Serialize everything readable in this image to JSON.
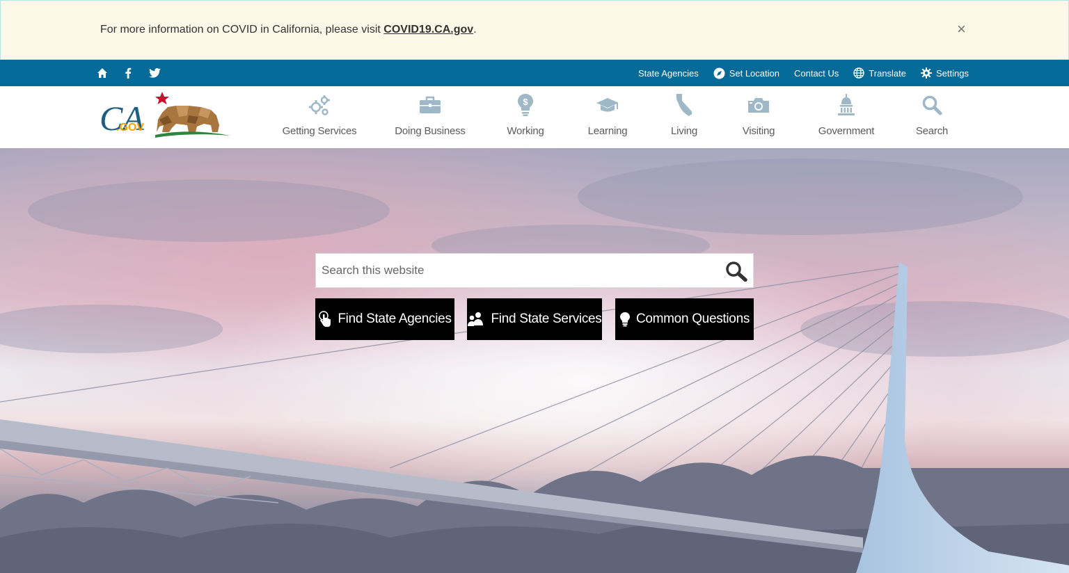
{
  "alert": {
    "text": "For more information on COVID in California, please visit ",
    "link": "COVID19.CA.gov",
    "suffix": ".",
    "close": "×"
  },
  "utility": {
    "icons": [
      "home-icon",
      "facebook-icon",
      "twitter-icon"
    ],
    "links": {
      "agencies": "State Agencies",
      "location": "Set Location",
      "contact": "Contact Us",
      "translate": "Translate",
      "settings": "Settings"
    }
  },
  "logo": {
    "text": "CA",
    "suffix": ".GOV"
  },
  "nav": {
    "items": [
      {
        "label": "Getting Services",
        "icon": "gears-icon"
      },
      {
        "label": "Doing Business",
        "icon": "briefcase-icon"
      },
      {
        "label": "Working",
        "icon": "lightbulb-dollar-icon"
      },
      {
        "label": "Learning",
        "icon": "graduation-cap-icon"
      },
      {
        "label": "Living",
        "icon": "california-icon"
      },
      {
        "label": "Visiting",
        "icon": "camera-icon"
      },
      {
        "label": "Government",
        "icon": "capitol-icon"
      },
      {
        "label": "Search",
        "icon": "search-icon"
      }
    ]
  },
  "search": {
    "placeholder": "Search this website"
  },
  "cta": {
    "agencies": "Find State Agencies",
    "services": "Find State Services",
    "questions": "Common Questions"
  },
  "colors": {
    "utility_bar": "#046b99",
    "alert_bg": "#fdf8e8",
    "nav_icon": "#9fb8c8",
    "cta_bg": "#000000"
  }
}
